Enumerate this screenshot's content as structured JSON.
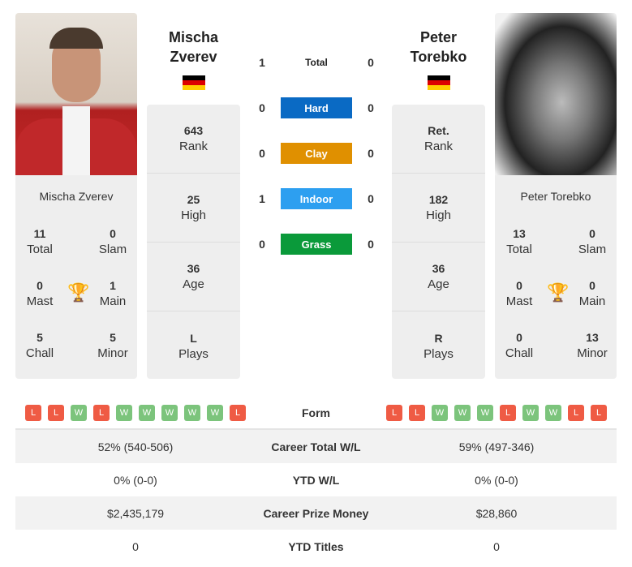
{
  "player1": {
    "name": "Mischa Zverev",
    "name_line1": "Mischa",
    "name_line2": "Zverev",
    "flag": "germany",
    "total": "11",
    "slam": "0",
    "mast": "0",
    "main": "1",
    "chall": "5",
    "minor": "5",
    "rank": "643",
    "high": "25",
    "age": "36",
    "plays": "L",
    "form": [
      "L",
      "L",
      "W",
      "L",
      "W",
      "W",
      "W",
      "W",
      "W",
      "L"
    ]
  },
  "player2": {
    "name": "Peter Torebko",
    "name_line1": "Peter",
    "name_line2": "Torebko",
    "flag": "germany",
    "total": "13",
    "slam": "0",
    "mast": "0",
    "main": "0",
    "chall": "0",
    "minor": "13",
    "rank": "Ret.",
    "high": "182",
    "age": "36",
    "plays": "R",
    "form": [
      "L",
      "L",
      "W",
      "W",
      "W",
      "L",
      "W",
      "W",
      "L",
      "L"
    ]
  },
  "labels": {
    "total": "Total",
    "slam": "Slam",
    "mast": "Mast",
    "main": "Main",
    "chall": "Chall",
    "minor": "Minor",
    "rank": "Rank",
    "high": "High",
    "age": "Age",
    "plays": "Plays"
  },
  "h2h": [
    {
      "label": "Total",
      "p1": "1",
      "p2": "0",
      "color": ""
    },
    {
      "label": "Hard",
      "p1": "0",
      "p2": "0",
      "color": "#0a6ac4"
    },
    {
      "label": "Clay",
      "p1": "0",
      "p2": "0",
      "color": "#e09000"
    },
    {
      "label": "Indoor",
      "p1": "1",
      "p2": "0",
      "color": "#2d9ff0"
    },
    {
      "label": "Grass",
      "p1": "0",
      "p2": "0",
      "color": "#0a9a3a"
    }
  ],
  "comparison": [
    {
      "label": "Form"
    },
    {
      "label": "Career Total W/L",
      "p1": "52% (540-506)",
      "p2": "59% (497-346)"
    },
    {
      "label": "YTD W/L",
      "p1": "0% (0-0)",
      "p2": "0% (0-0)"
    },
    {
      "label": "Career Prize Money",
      "p1": "$2,435,179",
      "p2": "$28,860"
    },
    {
      "label": "YTD Titles",
      "p1": "0",
      "p2": "0"
    }
  ],
  "colors": {
    "win": "#7cc47c",
    "loss": "#ef5b44",
    "trophy": "#3a6fb5"
  }
}
